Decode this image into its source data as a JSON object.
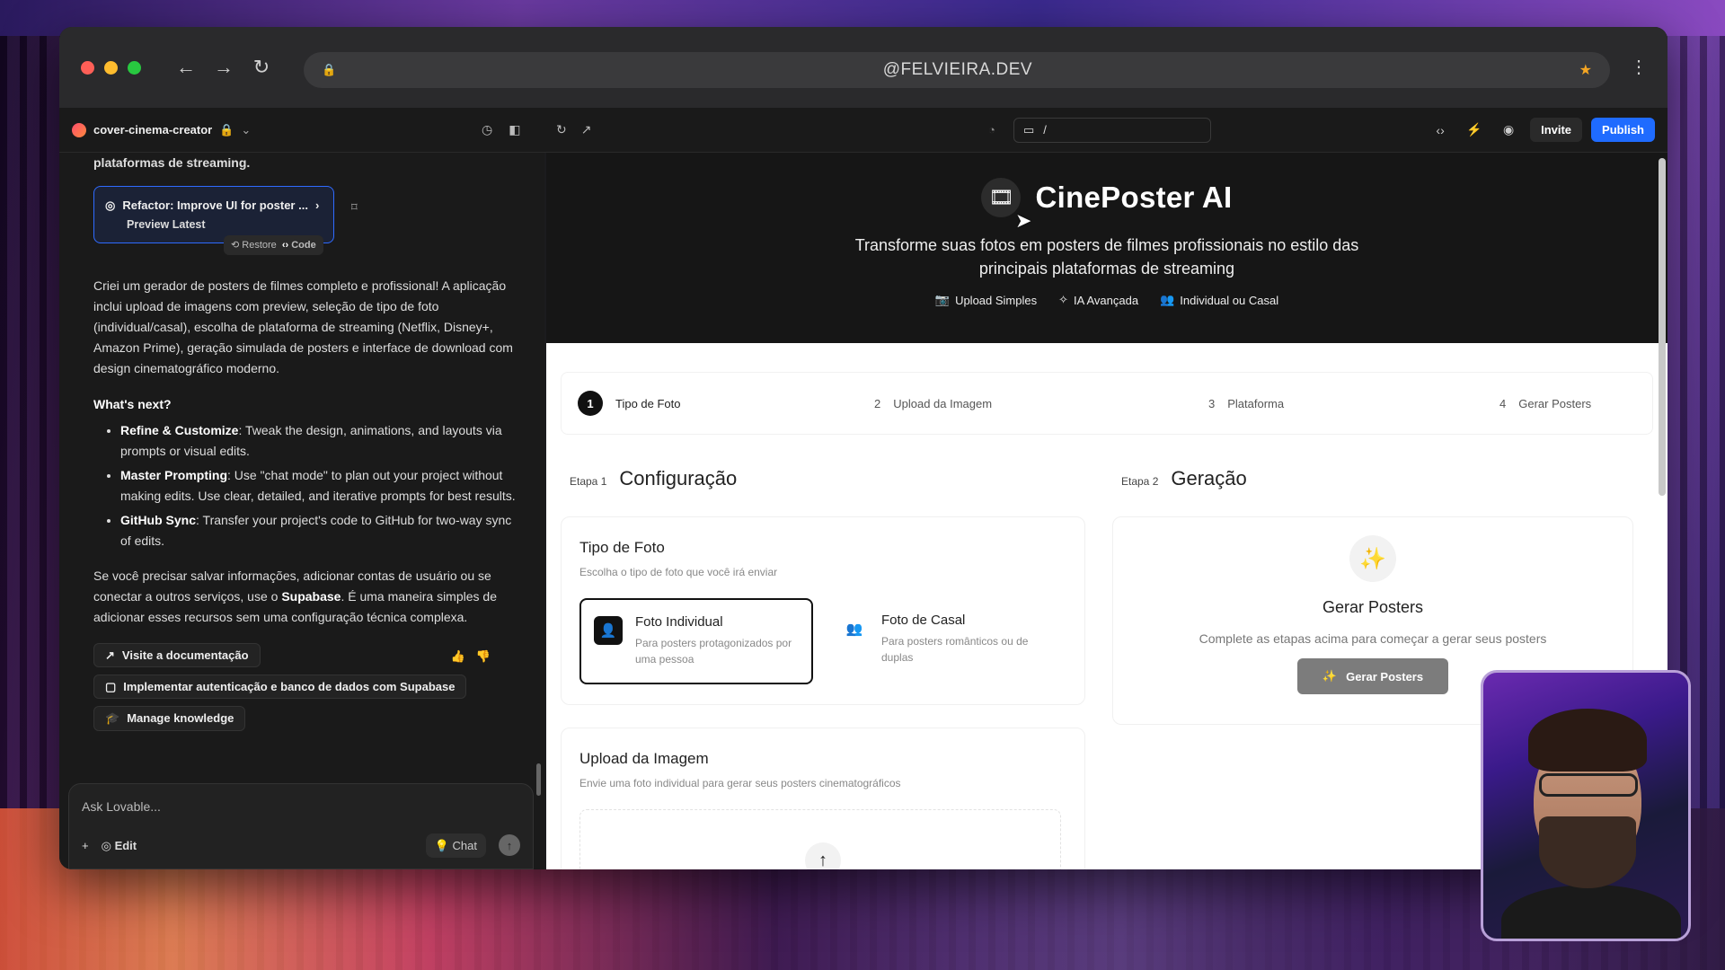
{
  "browser": {
    "url": "@FELVIEIRA.DEV"
  },
  "appbar": {
    "project_name": "cover-cinema-creator",
    "route": "/",
    "invite_label": "Invite",
    "publish_label": "Publish"
  },
  "chat": {
    "intro_tail": "plataformas de streaming.",
    "refactor_card": {
      "title": "Refactor: Improve UI for poster ...",
      "subtitle": "Preview Latest",
      "restore_label": "Restore",
      "code_label": "Code"
    },
    "summary": "Criei um gerador de posters de filmes completo e profissional! A aplicação inclui upload de imagens com preview, seleção de tipo de foto (individual/casal), escolha de plataforma de streaming (Netflix, Disney+, Amazon Prime), geração simulada de posters e interface de download com design cinematográfico moderno.",
    "whats_next_heading": "What's next?",
    "tips": [
      {
        "title": "Refine & Customize",
        "text": ": Tweak the design, animations, and layouts via prompts or visual edits."
      },
      {
        "title": "Master Prompting",
        "text": ": Use \"chat mode\" to plan out your project without making edits. Use clear, detailed, and iterative prompts for best results."
      },
      {
        "title": "GitHub Sync",
        "text": ": Transfer your project's code to GitHub for two-way sync of edits."
      }
    ],
    "supabase_pre": "Se você precisar salvar informações, adicionar contas de usuário ou se conectar a outros serviços, use o ",
    "supabase_bold": "Supabase",
    "supabase_post": ". É uma maneira simples de adicionar esses recursos sem uma configuração técnica complexa.",
    "chips": [
      "Visite a documentação",
      "Implementar autenticação e banco de dados com Supabase",
      "Manage knowledge"
    ],
    "composer": {
      "placeholder": "Ask Lovable...",
      "edit_label": "Edit",
      "chat_label": "Chat"
    }
  },
  "preview": {
    "hero": {
      "title": "CinePoster AI",
      "subtitle": "Transforme suas fotos em posters de filmes profissionais no estilo das principais plataformas de streaming",
      "features": [
        "Upload Simples",
        "IA Avançada",
        "Individual ou Casal"
      ]
    },
    "steps": [
      {
        "num": "1",
        "label": "Tipo de Foto"
      },
      {
        "num": "2",
        "label": "Upload da Imagem"
      },
      {
        "num": "3",
        "label": "Plataforma"
      },
      {
        "num": "4",
        "label": "Gerar Posters"
      }
    ],
    "config": {
      "etapa": "Etapa 1",
      "title": "Configuração"
    },
    "generation": {
      "etapa": "Etapa 2",
      "title": "Geração"
    },
    "tipo_foto": {
      "title": "Tipo de Foto",
      "desc": "Escolha o tipo de foto que você irá enviar",
      "options": [
        {
          "title": "Foto Individual",
          "desc": "Para posters protagonizados por uma pessoa"
        },
        {
          "title": "Foto de Casal",
          "desc": "Para posters românticos ou de duplas"
        }
      ]
    },
    "gerar": {
      "title": "Gerar Posters",
      "desc": "Complete as etapas acima para começar a gerar seus posters",
      "button": "Gerar Posters"
    },
    "upload": {
      "title": "Upload da Imagem",
      "desc": "Envie uma foto individual para gerar seus posters cinematográficos"
    }
  }
}
